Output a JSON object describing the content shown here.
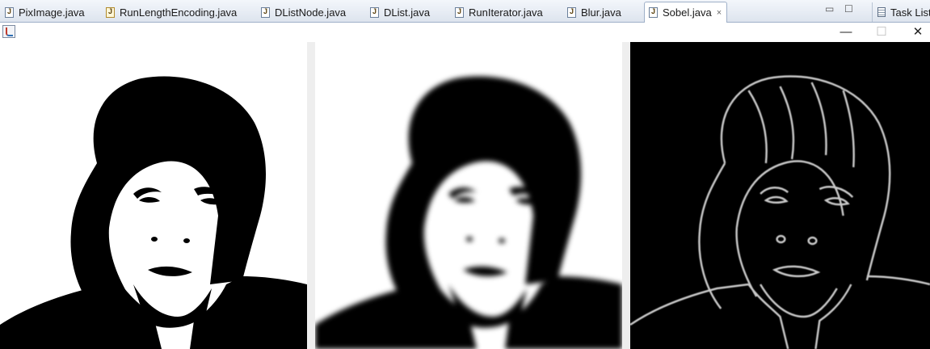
{
  "editor_tabs": [
    {
      "label": "PixImage.java",
      "icon": "java-file-icon"
    },
    {
      "label": "RunLengthEncoding.java",
      "icon": "java-file-warning-icon"
    },
    {
      "label": "DListNode.java",
      "icon": "java-file-icon"
    },
    {
      "label": "DList.java",
      "icon": "java-file-icon"
    },
    {
      "label": "RunIterator.java",
      "icon": "java-file-icon"
    },
    {
      "label": "Blur.java",
      "icon": "java-file-icon"
    },
    {
      "label": "Sobel.java",
      "icon": "java-file-icon",
      "active": true
    }
  ],
  "active_tab_close": "×",
  "view_controls": {
    "minimize": "▭",
    "maximize": "☐"
  },
  "side_view": {
    "label": "Task List",
    "icon": "task-list-icon"
  },
  "window": {
    "icon": "java-app-icon",
    "minimize": "—",
    "maximize": "☐",
    "close": "✕"
  },
  "panels": [
    {
      "name": "original-image",
      "background": "#ffffff",
      "fill": "#000000"
    },
    {
      "name": "blurred-image",
      "background": "#ffffff",
      "fill": "#000000"
    },
    {
      "name": "sobel-edge-image",
      "background": "#000000",
      "stroke": "#c8c8c8"
    }
  ]
}
